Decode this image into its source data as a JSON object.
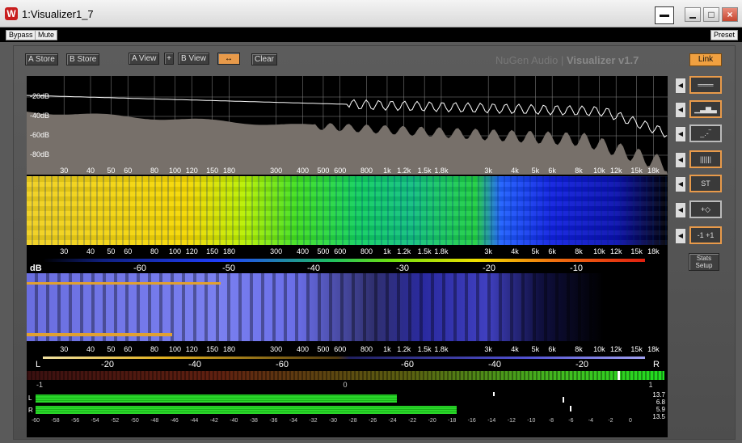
{
  "window": {
    "title": "1:Visualizer1_7",
    "app_icon": "w-logo-icon"
  },
  "menubar": {
    "bypass": "Bypass",
    "mute": "Mute",
    "preset": "Preset"
  },
  "toolbar": {
    "a_store": "A Store",
    "b_store": "B Store",
    "a_view": "A View",
    "plus": "+",
    "b_view": "B View",
    "clear": "Clear",
    "link": "Link"
  },
  "brand": {
    "name": "NuGen Audio",
    "product": "Visualizer v1.7"
  },
  "spectrum": {
    "db_labels": [
      "-20dB",
      "-40dB",
      "-60dB",
      "-80dB"
    ]
  },
  "freq_labels": [
    "30",
    "40",
    "50",
    "60",
    "80",
    "100",
    "120",
    "150",
    "180",
    "300",
    "400",
    "500",
    "600",
    "800",
    "1k",
    "1.2k",
    "1.5k",
    "1.8k",
    "3k",
    "4k",
    "5k",
    "6k",
    "8k",
    "10k",
    "12k",
    "15k",
    "18k"
  ],
  "color_scale": {
    "unit": "dB",
    "labels": [
      "-60",
      "-50",
      "-40",
      "-30",
      "-20",
      "-10"
    ]
  },
  "stereo_scale": {
    "left": "L",
    "right": "R",
    "labels": [
      "-20",
      "-40",
      "-60",
      "-60",
      "-40",
      "-20"
    ]
  },
  "correlation": {
    "labels": [
      "-1",
      "0",
      "1"
    ]
  },
  "level_meter": {
    "channels": [
      "L",
      "R"
    ],
    "ticks": [
      "-60",
      "-58",
      "-56",
      "-54",
      "-52",
      "-50",
      "-48",
      "-46",
      "-44",
      "-42",
      "-40",
      "-38",
      "-36",
      "-34",
      "-32",
      "-30",
      "-28",
      "-26",
      "-24",
      "-22",
      "-20",
      "-18",
      "-16",
      "-14",
      "-12",
      "-10",
      "-8",
      "-6",
      "-4",
      "-2",
      "0"
    ],
    "readouts": [
      "13.7",
      "6.8",
      "5.9",
      "13.5"
    ],
    "levels": {
      "L": -23.6,
      "R": -17.5
    }
  },
  "sidebar": {
    "buttons": [
      "lines-icon",
      "bars-icon",
      "smooth-icon",
      "gradient-icon",
      "ST",
      "zoom-icon",
      "-1 +1"
    ],
    "stats": "Stats Setup"
  },
  "colors": {
    "accent": "#e89a4a",
    "meter_green": "#33e033"
  }
}
